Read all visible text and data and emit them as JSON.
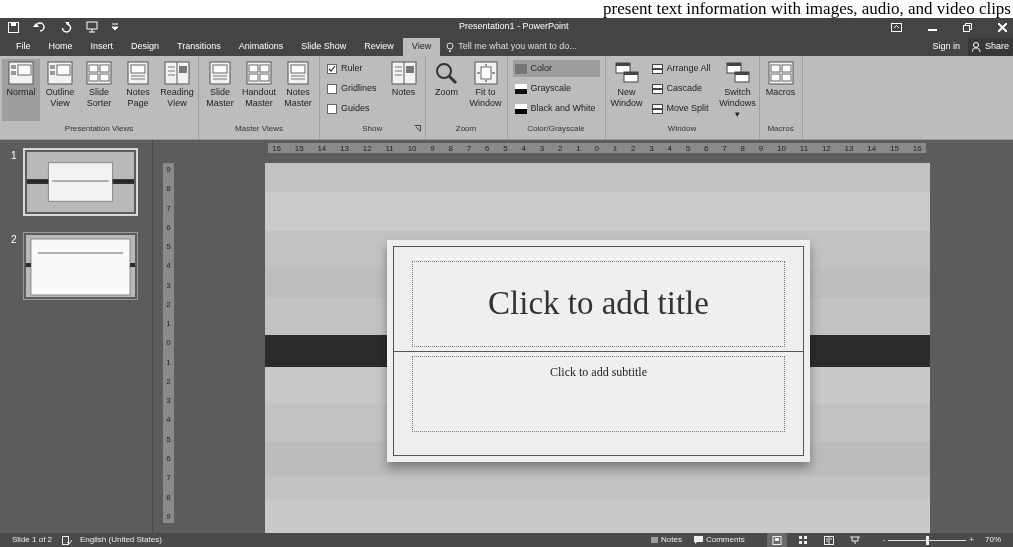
{
  "overlay_text": "present text information with images, audio, and video clips",
  "window": {
    "title": "Presentation1 - PowerPoint"
  },
  "tabs": [
    {
      "label": "File",
      "selected": false
    },
    {
      "label": "Home",
      "selected": false
    },
    {
      "label": "Insert",
      "selected": false
    },
    {
      "label": "Design",
      "selected": false
    },
    {
      "label": "Transitions",
      "selected": false
    },
    {
      "label": "Animations",
      "selected": false
    },
    {
      "label": "Slide Show",
      "selected": false
    },
    {
      "label": "Review",
      "selected": false
    },
    {
      "label": "View",
      "selected": true
    }
  ],
  "tell_me": {
    "placeholder": "Tell me what you want to do..."
  },
  "account": {
    "sign_in": "Sign in",
    "share": "Share"
  },
  "ribbon": {
    "groups": [
      {
        "label": "Presentation Views",
        "items": [
          {
            "kind": "large",
            "label": "Normal",
            "selected": true
          },
          {
            "kind": "large",
            "label": "Outline View",
            "selected": false
          },
          {
            "kind": "large",
            "label": "Slide Sorter",
            "selected": false
          },
          {
            "kind": "large",
            "label": "Notes Page",
            "selected": false
          },
          {
            "kind": "large",
            "label": "Reading View",
            "selected": false
          }
        ]
      },
      {
        "label": "Master Views",
        "items": [
          {
            "kind": "large",
            "label": "Slide Master"
          },
          {
            "kind": "large",
            "label": "Handout Master"
          },
          {
            "kind": "large",
            "label": "Notes Master"
          }
        ]
      },
      {
        "label": "Show",
        "launcher": true,
        "items": [
          {
            "kind": "check",
            "label": "Ruler",
            "checked": true
          },
          {
            "kind": "check",
            "label": "Gridlines",
            "checked": false
          },
          {
            "kind": "check",
            "label": "Guides",
            "checked": false
          },
          {
            "kind": "large",
            "label": "Notes"
          }
        ]
      },
      {
        "label": "Zoom",
        "items": [
          {
            "kind": "large",
            "label": "Zoom"
          },
          {
            "kind": "large",
            "label": "Fit to Window"
          }
        ]
      },
      {
        "label": "Color/Grayscale",
        "items": [
          {
            "kind": "swatch",
            "label": "Color",
            "selected": true
          },
          {
            "kind": "swatch",
            "label": "Grayscale",
            "selected": false
          },
          {
            "kind": "swatch",
            "label": "Black and White",
            "selected": false
          }
        ]
      },
      {
        "label": "Window",
        "items": [
          {
            "kind": "large",
            "label": "New Window"
          },
          {
            "kind": "small",
            "label": "Arrange All"
          },
          {
            "kind": "small",
            "label": "Cascade"
          },
          {
            "kind": "small",
            "label": "Move Split"
          },
          {
            "kind": "large",
            "label": "Switch Windows ▾"
          }
        ]
      },
      {
        "label": "Macros",
        "items": [
          {
            "kind": "large",
            "label": "Macros"
          }
        ]
      }
    ]
  },
  "horizontal_ruler": [
    "16",
    "15",
    "14",
    "13",
    "12",
    "11",
    "10",
    "9",
    "8",
    "7",
    "6",
    "5",
    "4",
    "3",
    "2",
    "1",
    "0",
    "1",
    "2",
    "3",
    "4",
    "5",
    "6",
    "7",
    "8",
    "9",
    "10",
    "11",
    "12",
    "13",
    "14",
    "15",
    "16"
  ],
  "vertical_ruler": [
    "9",
    "8",
    "7",
    "6",
    "5",
    "4",
    "3",
    "2",
    "1",
    "0",
    "1",
    "2",
    "3",
    "4",
    "5",
    "6",
    "7",
    "8",
    "9"
  ],
  "thumbnails": [
    {
      "number": "1",
      "selected": true
    },
    {
      "number": "2",
      "selected": false
    }
  ],
  "slide": {
    "title_placeholder": "Click to add title",
    "subtitle_placeholder": "Click to add subtitle"
  },
  "status_bar": {
    "slide_info": "Slide 1 of 2",
    "language": "English (United States)",
    "notes": "Notes",
    "comments": "Comments",
    "views": [
      {
        "selected": true
      },
      {
        "selected": false
      },
      {
        "selected": false
      },
      {
        "selected": false
      }
    ],
    "zoom_minus": "-",
    "zoom_plus": "+",
    "zoom": {
      "level": 0.5
    },
    "zoom_percent": "70%"
  }
}
